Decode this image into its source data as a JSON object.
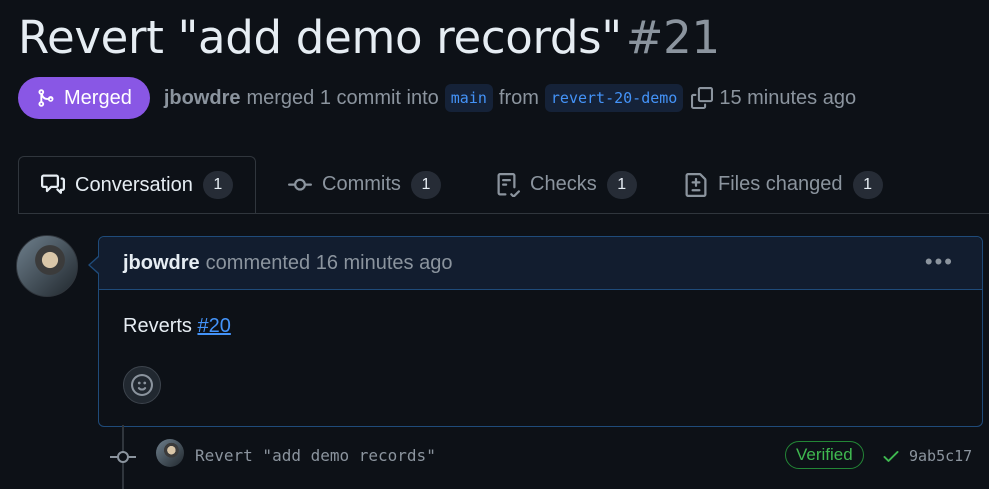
{
  "pr": {
    "title": "Revert \"add demo records\"",
    "number": "#21",
    "status": "Merged",
    "author": "jbowdre",
    "merge_text": "merged 1 commit into",
    "base_branch": "main",
    "from_text": "from",
    "head_branch": "revert-20-demo",
    "time": "15 minutes ago"
  },
  "tabs": [
    {
      "label": "Conversation",
      "count": "1",
      "icon": "comment-discussion-icon"
    },
    {
      "label": "Commits",
      "count": "1",
      "icon": "git-commit-icon"
    },
    {
      "label": "Checks",
      "count": "1",
      "icon": "checklist-icon"
    },
    {
      "label": "Files changed",
      "count": "1",
      "icon": "file-diff-icon"
    }
  ],
  "comment": {
    "author": "jbowdre",
    "action": "commented 16 minutes ago",
    "body_text": "Reverts",
    "body_ref": "#20"
  },
  "commit": {
    "message": "Revert \"add demo records\"",
    "verified": "Verified",
    "sha": "9ab5c17"
  },
  "colors": {
    "background": "#0d1117",
    "merged": "#8957e5",
    "link": "#4493f8",
    "verified": "#3fb950"
  }
}
